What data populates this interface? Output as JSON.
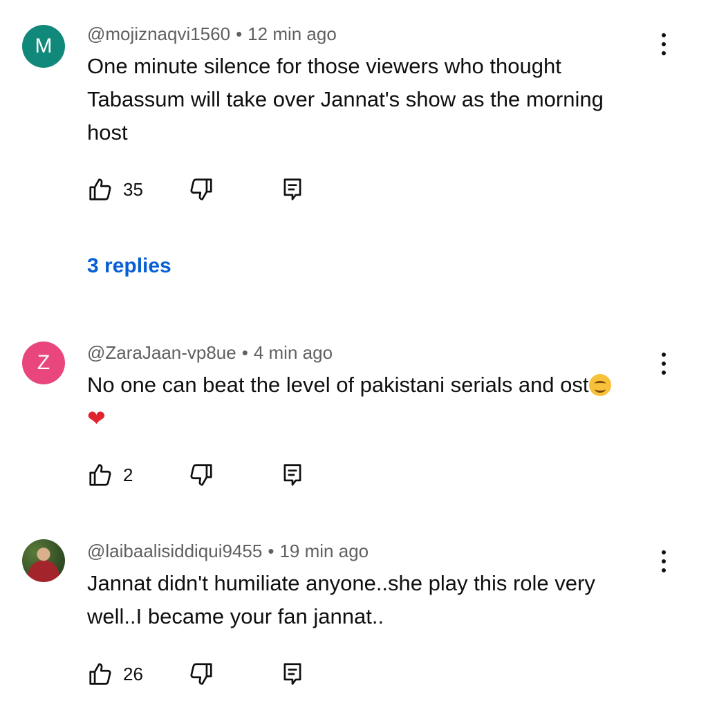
{
  "comments": [
    {
      "avatar_letter": "M",
      "avatar_color": "#11897a",
      "username": "@mojiznaqvi1560",
      "separator": "•",
      "time": "12 min ago",
      "lines": [
        "One minute silence for those viewers who thought",
        "Tabassum will take over Jannat's show as the morning",
        "host"
      ],
      "likes": "35",
      "replies_label": "3 replies"
    },
    {
      "avatar_letter": "Z",
      "avatar_color": "#e8467c",
      "username": "@ZaraJaan-vp8ue",
      "separator": "•",
      "time": "4 min ago",
      "lines": [
        "No one can beat the level of pakistani serials and ost"
      ],
      "emoji_smile": "smiling-face-emoji",
      "emoji_heart": "❤",
      "likes": "2"
    },
    {
      "avatar_image": "profile-photo",
      "username": "@laibaalisiddiqui9455",
      "separator": "•",
      "time": "19 min ago",
      "lines": [
        "Jannat didn't humiliate anyone..she play this role very",
        "well..I became your fan jannat.."
      ],
      "likes": "26"
    }
  ],
  "icons": {
    "like": "thumbs-up-icon",
    "dislike": "thumbs-down-icon",
    "reply": "reply-comment-icon",
    "menu": "more-vert-icon"
  },
  "colors": {
    "link": "#065fd4",
    "meta": "#606060"
  }
}
